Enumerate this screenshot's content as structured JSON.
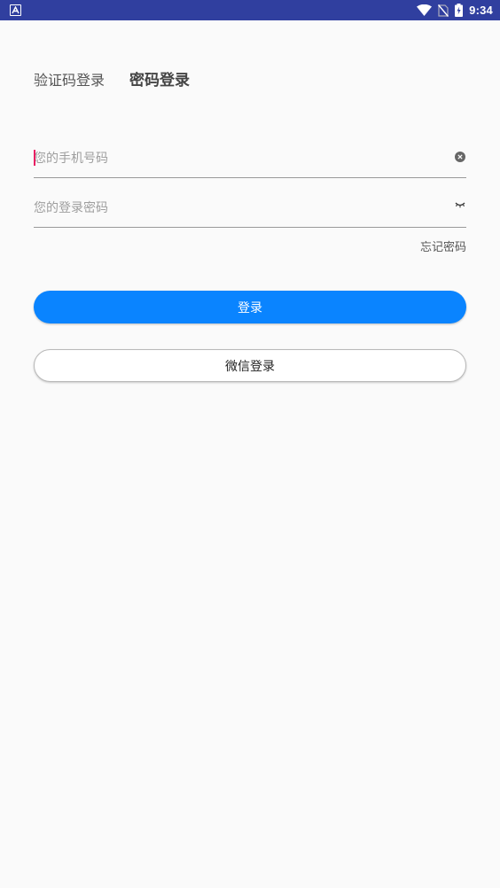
{
  "status_bar": {
    "time": "9:34",
    "icons": [
      "app-notification-icon",
      "wifi-icon",
      "no-sim-icon",
      "battery-charging-icon"
    ]
  },
  "tabs": {
    "sms_login": "验证码登录",
    "password_login": "密码登录",
    "active": "password_login"
  },
  "form": {
    "phone_placeholder": "您的手机号码",
    "phone_value": "",
    "password_placeholder": "您的登录密码",
    "password_value": "",
    "forgot_password": "忘记密码"
  },
  "buttons": {
    "login": "登录",
    "wechat_login": "微信登录"
  },
  "colors": {
    "status_bar": "#303f9f",
    "primary": "#0a84ff",
    "caret": "#e91e63",
    "background": "#fafafa"
  }
}
